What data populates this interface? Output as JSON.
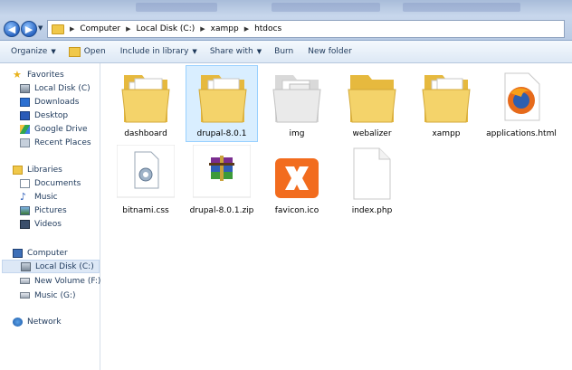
{
  "address_bar": {
    "breadcrumbs": [
      "Computer",
      "Local Disk (C:)",
      "xampp",
      "htdocs"
    ]
  },
  "toolbar": {
    "organize": "Organize",
    "open": "Open",
    "include_in_library": "Include in library",
    "share_with": "Share with",
    "burn": "Burn",
    "new_folder": "New folder"
  },
  "sidebar": {
    "favorites_header": "Favorites",
    "favorites": [
      "Local Disk (C)",
      "Downloads",
      "Desktop",
      "Google Drive",
      "Recent Places"
    ],
    "libraries_header": "Libraries",
    "libraries": [
      "Documents",
      "Music",
      "Pictures",
      "Videos"
    ],
    "computer_header": "Computer",
    "drives": [
      "Local Disk (C:)",
      "New Volume (F:)",
      "Music (G:)"
    ],
    "network": "Network"
  },
  "files": [
    {
      "name": "dashboard",
      "type": "folder-firefox"
    },
    {
      "name": "drupal-8.0.1",
      "type": "folder"
    },
    {
      "name": "img",
      "type": "folder-docs"
    },
    {
      "name": "webalizer",
      "type": "folder-plain"
    },
    {
      "name": "xampp",
      "type": "folder"
    },
    {
      "name": "applications.html",
      "type": "firefox-html"
    },
    {
      "name": "bitnami.css",
      "type": "css"
    },
    {
      "name": "drupal-8.0.1.zip",
      "type": "winrar"
    },
    {
      "name": "favicon.ico",
      "type": "xampp-ico"
    },
    {
      "name": "index.php",
      "type": "blank"
    }
  ],
  "colors": {
    "accent": "#1e395b",
    "selection": "#cce8ff",
    "folder": "#f0c84a"
  }
}
